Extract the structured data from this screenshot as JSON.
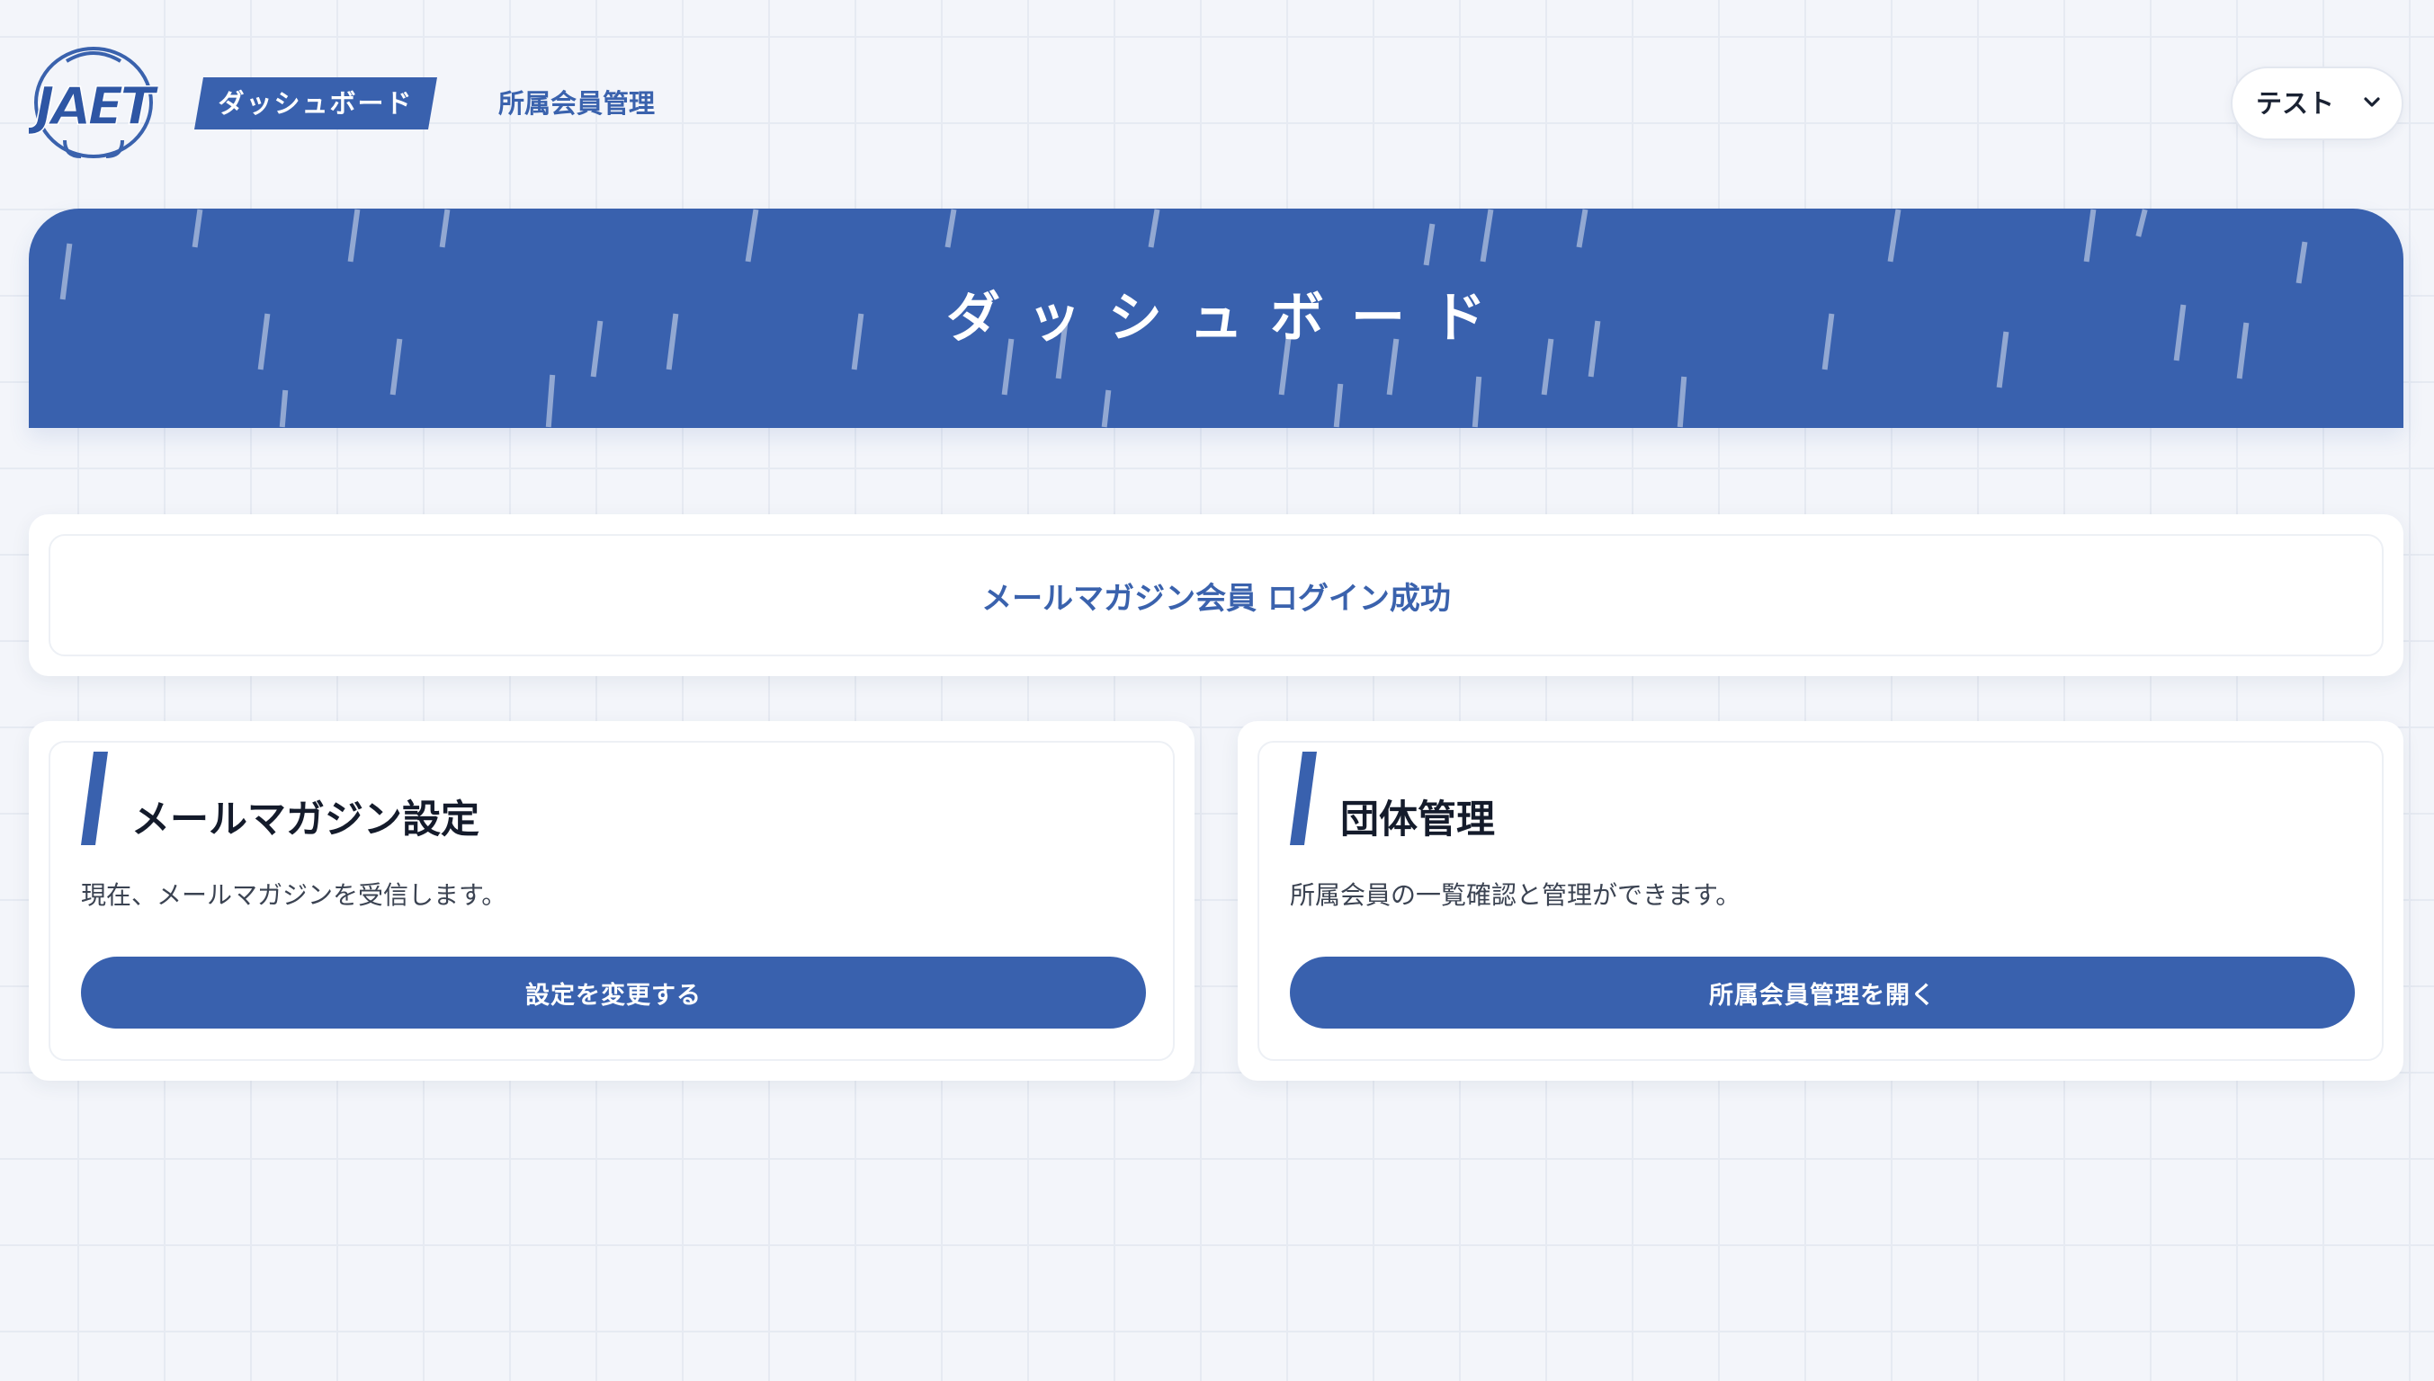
{
  "header": {
    "logo_text": "JAET",
    "nav": {
      "active_label": "ダッシュボード",
      "link_label": "所属会員管理"
    },
    "user_menu": {
      "name": "テスト",
      "icon": "chevron-down-icon"
    }
  },
  "banner": {
    "title": "ダッシュボード"
  },
  "notice": {
    "message": "メールマガジン会員 ログイン成功"
  },
  "cards": [
    {
      "title": "メールマガジン設定",
      "description": "現在、メールマガジンを受信します。",
      "button_label": "設定を変更する"
    },
    {
      "title": "団体管理",
      "description": "所属会員の一覧確認と管理ができます。",
      "button_label": "所属会員管理を開く"
    }
  ],
  "colors": {
    "primary": "#3961ae",
    "text_link": "#3a62ad",
    "background": "#f3f5fa",
    "card_background": "#ffffff"
  }
}
